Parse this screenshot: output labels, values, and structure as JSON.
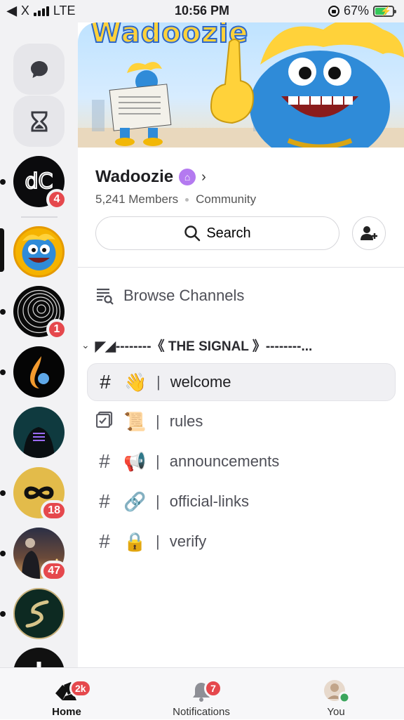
{
  "status_bar": {
    "carrier": "X",
    "network": "LTE",
    "time": "10:56 PM",
    "battery": "67%",
    "battery_level": 0.67
  },
  "server_rail": {
    "servers": [
      {
        "name": "dc-server",
        "badge": "4"
      },
      {
        "name": "wadoozie-server",
        "badge": ""
      },
      {
        "name": "spiral-server",
        "badge": "1"
      },
      {
        "name": "flame-server",
        "badge": ""
      },
      {
        "name": "hacker-server",
        "badge": ""
      },
      {
        "name": "infinity-server",
        "badge": "18"
      },
      {
        "name": "city-server",
        "badge": "47"
      },
      {
        "name": "s-server",
        "badge": ""
      }
    ]
  },
  "banner": {
    "title": "Wadoozie"
  },
  "server": {
    "name": "Wadoozie",
    "members": "5,241 Members",
    "type": "Community"
  },
  "actions": {
    "search_label": "Search"
  },
  "browse_label": "Browse Channels",
  "category": {
    "name": "◤◢--------《 THE SIGNAL 》--------..."
  },
  "channels": [
    {
      "emoji": "👋",
      "name": "welcome",
      "active": true
    },
    {
      "emoji": "📜",
      "name": "rules"
    },
    {
      "emoji": "📢",
      "name": "announcements"
    },
    {
      "emoji": "🔗",
      "name": "official-links"
    },
    {
      "emoji": "🔒",
      "name": "verify"
    }
  ],
  "channel_separator": "|",
  "tabbar": {
    "home": {
      "label": "Home",
      "badge": "2k"
    },
    "notifications": {
      "label": "Notifications",
      "badge": "7"
    },
    "you": {
      "label": "You"
    }
  },
  "colors": {
    "badge": "#e5484d",
    "boost": "#b47af0",
    "online": "#3ba55c"
  }
}
